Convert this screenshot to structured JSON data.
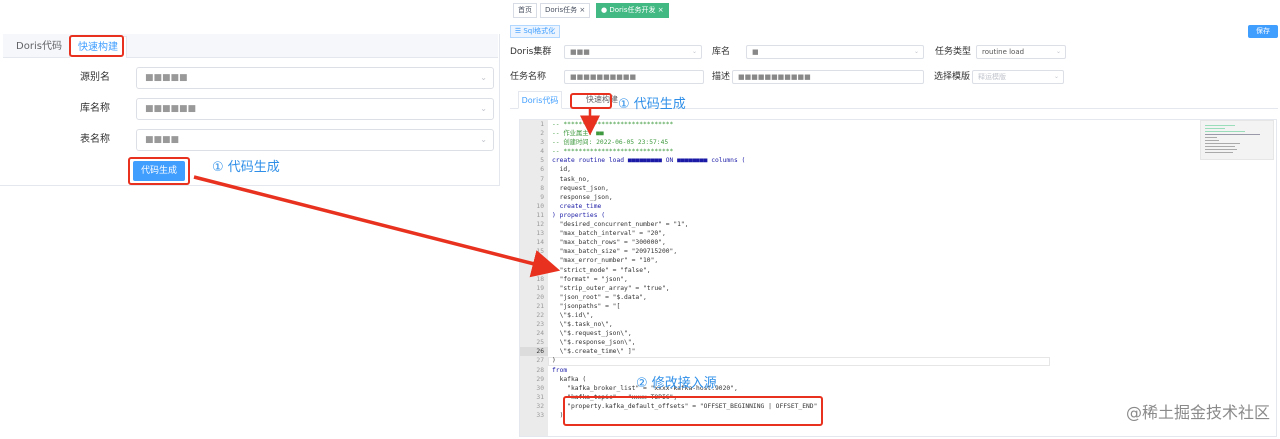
{
  "left_panel": {
    "tabs": [
      "Doris代码",
      "快速构建"
    ],
    "fields": [
      {
        "label": "源别名",
        "value": "■■■■■"
      },
      {
        "label": "库名称",
        "value": "■■■■■■"
      },
      {
        "label": "表名称",
        "value": "■■■■"
      }
    ],
    "generate_button": "代码生成",
    "annotation": "① 代码生成"
  },
  "right_panel": {
    "top_tabs": [
      "首页",
      "Doris任务",
      "Doris任务开发"
    ],
    "format_button": "Sql格式化",
    "save_button": "保存",
    "form": {
      "cluster_label": "Doris集群",
      "cluster_value": "■■■",
      "db_label": "库名",
      "db_value": "■",
      "task_type_label": "任务类型",
      "task_type_value": "routine load",
      "task_name_label": "任务名称",
      "task_name_value": "■■■■■■■■■■",
      "desc_label": "描述",
      "desc_value": "■■■■■■■■■■■",
      "template_label": "选择模版",
      "template_placeholder": "释运模版"
    },
    "editor_tabs": [
      "Doris代码",
      "快速构建"
    ],
    "annotation_1": "① 代码生成",
    "annotation_2": "② 修改接入源",
    "code_lines": [
      "-- *****************************",
      "-- 作业属主: ■■",
      "-- 创建时间: 2022-06-05 23:57:45",
      "-- *****************************",
      "create routine load ■■■■■■■■■ ON ■■■■■■■■ columns (",
      "  id,",
      "  task_no,",
      "  request_json,",
      "  response_json,",
      "  create_time",
      ") properties (",
      "  \"desired_concurrent_number\" = \"1\",",
      "  \"max_batch_interval\" = \"20\",",
      "  \"max_batch_rows\" = \"300000\",",
      "  \"max_batch_size\" = \"209715200\",",
      "  \"max_error_number\" = \"10\",",
      "  \"strict_mode\" = \"false\",",
      "  \"format\" = \"json\",",
      "  \"strip_outer_array\" = \"true\",",
      "  \"json_root\" = \"$.data\",",
      "  \"jsonpaths\" = \"[",
      "  \\\"$.id\\\",",
      "  \\\"$.task_no\\\",",
      "  \\\"$.request_json\\\",",
      "  \\\"$.response_json\\\",",
      "  \\\"$.create_time\\\" ]\"",
      ")",
      "from",
      "  kafka (",
      "    \"kafka_broker_list\" = \"xxxx-kafka-host:9020\",",
      "    \"kafka_topic\" = \"xxxx-TOPIC\",",
      "    \"property.kafka_default_offsets\" = \"OFFSET_BEGINNING | OFFSET_END\"",
      "  )"
    ]
  },
  "watermark": "@稀土掘金技术社区",
  "colors": {
    "primary": "#409eff",
    "annotation_red": "#e8321f",
    "annotation_blue": "#2f8fe8"
  }
}
